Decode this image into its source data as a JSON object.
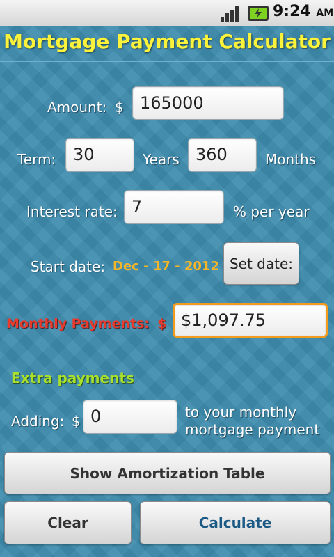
{
  "status_bar": {
    "time": "9:24",
    "ampm": "AM",
    "icons": [
      "signal-icon",
      "battery-charging-icon"
    ]
  },
  "app": {
    "title": "Mortgage Payment Calculator"
  },
  "form": {
    "amount_label": "Amount:",
    "currency_symbol": "$",
    "amount_value": "165000",
    "term_label": "Term:",
    "term_years_value": "30",
    "years_label": "Years",
    "term_months_value": "360",
    "months_label": "Months",
    "interest_label": "Interest rate:",
    "interest_value": "7",
    "interest_unit": "% per year",
    "start_date_label": "Start date:",
    "start_date_value": "Dec - 17 - 2012",
    "set_date_button": "Set date:",
    "monthly_label": "Monthly Payments:",
    "monthly_currency": "$",
    "monthly_value": "$1,097.75"
  },
  "extra": {
    "title": "Extra payments",
    "adding_label": "Adding:",
    "currency_symbol": "$",
    "adding_value": "0",
    "description_line1": "to your monthly",
    "description_line2": "mortgage payment"
  },
  "buttons": {
    "amortization": "Show Amortization Table",
    "clear": "Clear",
    "calculate": "Calculate"
  },
  "colors": {
    "title": "#fbf33b",
    "date": "#f6b627",
    "monthly_label": "#e83b2d",
    "extra_title": "#a8e02c",
    "focus": "#f39b1c",
    "background": "#3f8cae"
  }
}
